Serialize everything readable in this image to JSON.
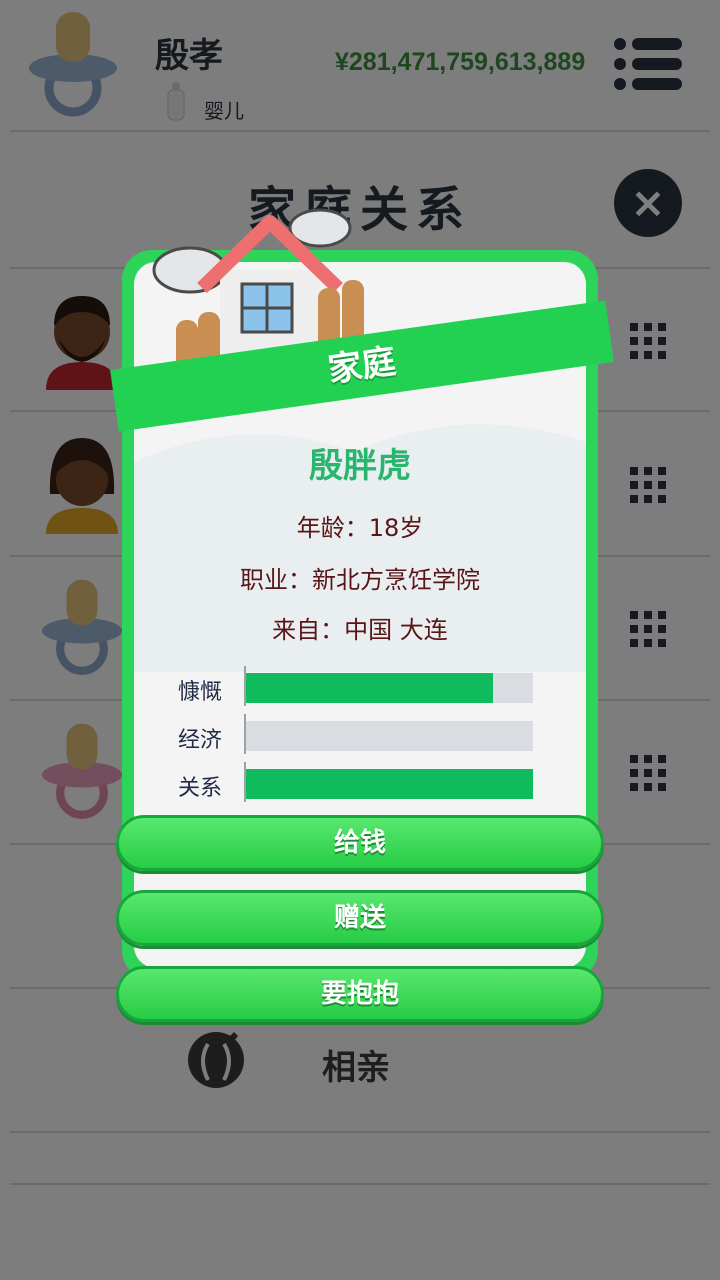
{
  "header": {
    "name": "殷孝",
    "life_stage": "婴儿",
    "money": "¥281,471,759,613,889",
    "menu_icon": "menu-icon"
  },
  "section": {
    "title": "家庭关系",
    "close_label": "×"
  },
  "family_rows": [
    {
      "avatar": "father-avatar"
    },
    {
      "avatar": "mother-avatar"
    },
    {
      "avatar": "pacifier-blue-avatar"
    },
    {
      "avatar": "pacifier-pink-avatar"
    }
  ],
  "love_item": {
    "label": "相亲"
  },
  "modal": {
    "banner": "家庭",
    "person_name": "殷胖虎",
    "age_label": "年龄：",
    "age_value": "18岁",
    "job_label": "职业：",
    "job_value": "新北方烹饪学院",
    "from_label": "来自：",
    "from_value": "中国 大连",
    "stats": [
      {
        "label": "慷慨",
        "value": 0.86
      },
      {
        "label": "经济",
        "value": 0.0
      },
      {
        "label": "关系",
        "value": 1.0
      }
    ],
    "buttons": [
      "给钱",
      "赠送",
      "要抱抱"
    ]
  },
  "colors": {
    "accent_green": "#2ed35a",
    "bar_fill": "#0fbb5c",
    "money_green": "#3e8f3e",
    "dark": "#2b3440"
  }
}
